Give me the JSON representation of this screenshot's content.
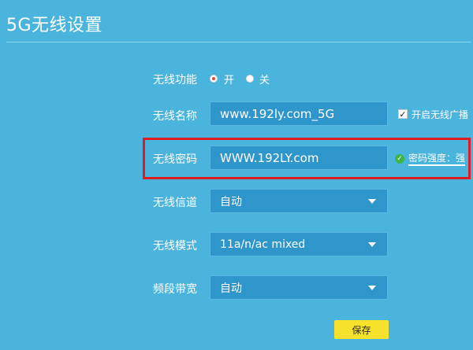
{
  "page": {
    "title": "5G无线设置"
  },
  "wireless_function": {
    "label": "无线功能",
    "options": [
      {
        "label": "开",
        "checked": true
      },
      {
        "label": "关",
        "checked": false
      }
    ]
  },
  "wireless_name": {
    "label": "无线名称",
    "value": "www.192ly.com_5G",
    "broadcast": {
      "label": "开启无线广播",
      "checked": true
    }
  },
  "wireless_password": {
    "label": "无线密码",
    "value": "WWW.192LY.com",
    "strength_text": "密码强度：强"
  },
  "wireless_channel": {
    "label": "无线信道",
    "value": "自动"
  },
  "wireless_mode": {
    "label": "无线模式",
    "value": "11a/n/ac mixed"
  },
  "bandwidth": {
    "label": "频段带宽",
    "value": "自动"
  },
  "save_label": "保存",
  "colors": {
    "background": "#4ab4dc",
    "field": "#2f96cc",
    "highlight_border": "#e11b22",
    "save_button": "#f6e12c",
    "check_ok": "#3db34a"
  },
  "icons": [
    "radio-icon",
    "checkbox-icon",
    "check-circle-icon",
    "dropdown-caret-icon"
  ]
}
